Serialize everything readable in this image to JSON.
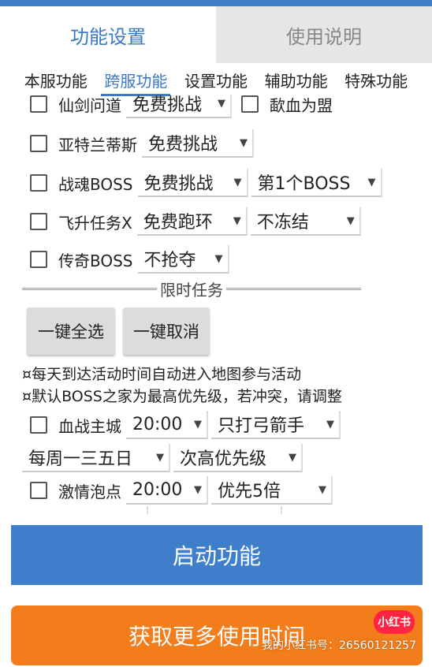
{
  "tabs": [
    {
      "label": "功能设置"
    },
    {
      "label": "使用说明"
    }
  ],
  "subtabs": [
    {
      "label": "本服功能"
    },
    {
      "label": "跨服功能"
    },
    {
      "label": "设置功能"
    },
    {
      "label": "辅助功能"
    },
    {
      "label": "特殊功能"
    }
  ],
  "rows": {
    "xianjian": {
      "label": "仙剑问道",
      "select": "免费挑战"
    },
    "shaxue": {
      "label": "歃血为盟"
    },
    "yatelan": {
      "label": "亚特兰蒂斯",
      "select": "免费挑战"
    },
    "zhanhun": {
      "label": "战魂BOSS",
      "select1": "免费挑战",
      "select2": "第1个BOSS"
    },
    "feisheng": {
      "label": "飞升任务Ⅹ",
      "select1": "免费跑环",
      "select2": "不冻结"
    },
    "chuanqi": {
      "label": "传奇BOSS",
      "select": "不抢夺"
    }
  },
  "section": {
    "title": "限时任务"
  },
  "buttons": {
    "select_all": "一键全选",
    "deselect_all": "一键取消"
  },
  "notes": [
    "¤每天到达活动时间自动进入地图参与活动",
    "¤默认BOSS之家为最高优先级，若冲突，请调整"
  ],
  "timed": {
    "xuezhan": {
      "label": "血战主城",
      "time": "20:00",
      "mode": "只打弓箭手",
      "days": "每周一三五日",
      "priority": "次高优先级"
    },
    "jiqing": {
      "label": "激情泡点",
      "time": "20:00",
      "mode": "优先5倍"
    }
  },
  "actions": {
    "start": "启动功能",
    "more": "获取更多使用时间"
  },
  "watermark": {
    "badge": "小红书",
    "text": "我的小红书号：26560121257"
  },
  "colors": {
    "accent": "#3e7ecb",
    "orange": "#f27d1a",
    "badge": "#ff2442"
  }
}
